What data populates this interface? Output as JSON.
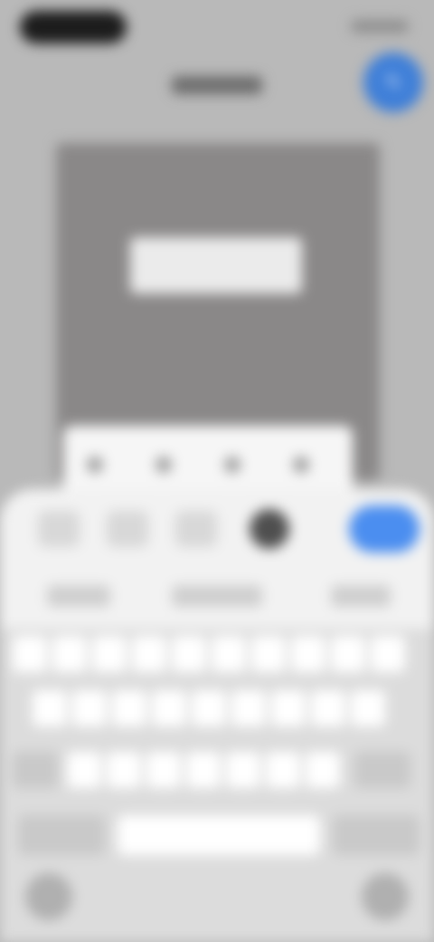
{
  "status_bar": {
    "time": "",
    "indicators": ""
  },
  "header": {
    "title": "",
    "fab_icon": "edit-icon"
  },
  "preview": {
    "label": ""
  },
  "popup": {
    "items": [
      "",
      "",
      "",
      ""
    ]
  },
  "toolbar": {
    "primary_button": ""
  },
  "suggestions": [
    "",
    "",
    ""
  ],
  "keyboard": {
    "rows": [
      "",
      "",
      "",
      ""
    ]
  },
  "colors": {
    "accent": "#4b8ef0",
    "fab": "#3f7fd8",
    "preview_bg": "#8a8888",
    "sheet_bg": "#f2f2f2"
  }
}
